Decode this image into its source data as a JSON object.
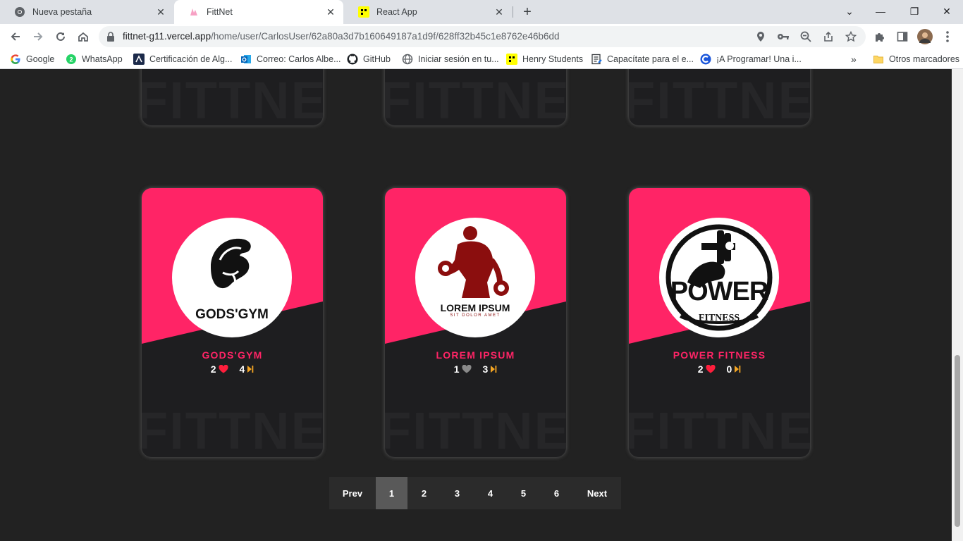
{
  "browser": {
    "tabs": [
      {
        "title": "Nueva pestaña"
      },
      {
        "title": "FittNet"
      },
      {
        "title": "React App"
      }
    ],
    "url_host": "fittnet-g11.vercel.app",
    "url_path": "/home/user/CarlosUser/62a80a3d7b160649187a1d9f/628ff32b45c1e8762e46b6dd",
    "bookmarks": [
      {
        "label": "Google",
        "icon": "google-icon"
      },
      {
        "label": "WhatsApp",
        "icon": "whatsapp-icon"
      },
      {
        "label": "Certificación de Alg...",
        "icon": "algorithm-icon"
      },
      {
        "label": "Correo: Carlos Albe...",
        "icon": "outlook-icon"
      },
      {
        "label": "GitHub",
        "icon": "github-icon"
      },
      {
        "label": "Iniciar sesión en tu...",
        "icon": "globe-icon"
      },
      {
        "label": "Henry Students",
        "icon": "henry-icon"
      },
      {
        "label": "Capacítate para el e...",
        "icon": "doc-icon"
      },
      {
        "label": "¡A Programar! Una i...",
        "icon": "c-icon"
      }
    ],
    "bookmarks_more": "»",
    "other_bookmarks": "Otros marcadores"
  },
  "page": {
    "watermark": "FITTNET",
    "gyms": [
      {
        "name": "GODS'GYM",
        "likes": "2",
        "like_color": "#ff1e3c",
        "visits": "4",
        "logo_text": "GODS'GYM"
      },
      {
        "name": "LOREM IPSUM",
        "likes": "1",
        "like_color": "#8a8a8a",
        "visits": "3",
        "logo_text": "LOREM IPSUM",
        "logo_sub": "SIT DOLOR AMET"
      },
      {
        "name": "POWER FITNESS",
        "likes": "2",
        "like_color": "#ff1e3c",
        "visits": "0",
        "logo_text": "POWER",
        "logo_sub": "FITNESS"
      }
    ],
    "pagination": {
      "prev": "Prev",
      "pages": [
        "1",
        "2",
        "3",
        "4",
        "5",
        "6"
      ],
      "current": "1",
      "next": "Next"
    }
  },
  "colors": {
    "accent_pink": "#ff2466",
    "card_bg": "#1e1e20",
    "page_bg": "#222222",
    "visit_icon": "#f5a623"
  }
}
